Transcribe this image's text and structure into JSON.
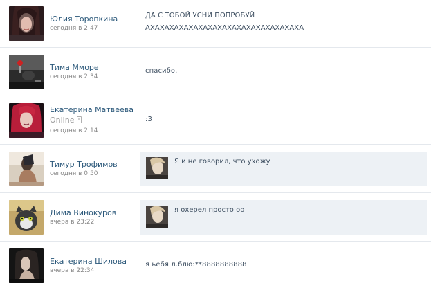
{
  "dialogs": [
    {
      "name": "Юлия Торопкина",
      "time": "сегодня в 2:47",
      "message_lines": [
        "ДА С ТОБОЙ УСНИ ПОПРОБУЙ",
        "АХАХАХАХАХАХАХАХАХАХАХАХАХАХАХАХА"
      ]
    },
    {
      "name": "Тима Мморе",
      "time": "сегодня в 2:34",
      "message": "спасибо."
    },
    {
      "name": "Екатерина Матвеева",
      "online": "Online",
      "time": "сегодня в 2:14",
      "message": ":3"
    },
    {
      "name": "Тимур Трофимов",
      "time": "сегодня в 0:50",
      "reply": "Я и не говорил, что ухожу"
    },
    {
      "name": "Дима Винокуров",
      "time": "вчера в 23:22",
      "reply": "я охерел просто оо"
    },
    {
      "name": "Екатерина Шилова",
      "time": "вчера в 22:34",
      "message": "я ьебя л.блю:**8888888888"
    }
  ],
  "colors": {
    "name_link": "#2b587a",
    "time": "#888888",
    "message_text": "#3d4e60",
    "reply_background": "#edf1f5",
    "divider": "#e4e8ed"
  },
  "icons": {
    "online_device": "mobile-icon"
  }
}
